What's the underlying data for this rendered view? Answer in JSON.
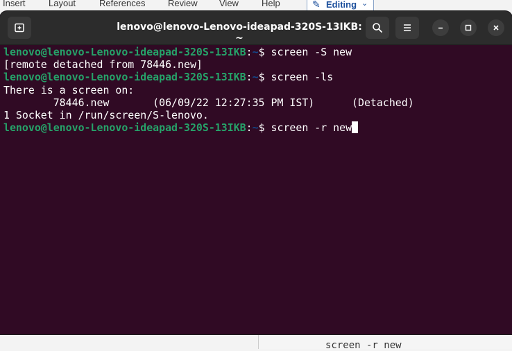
{
  "background_app": {
    "menu": [
      "Insert",
      "Layout",
      "References",
      "Review",
      "View",
      "Help"
    ],
    "mode_label": "Editing",
    "doc_text": "screen -r new"
  },
  "window": {
    "title": "lenovo@lenovo-Lenovo-ideapad-320S-13IKB: ~",
    "new_tab_icon": "new-tab-icon",
    "search_icon": "search-icon",
    "menu_icon": "hamburger-menu-icon",
    "minimize_icon": "minimize-icon",
    "maximize_icon": "maximize-icon",
    "close_icon": "close-icon"
  },
  "colors": {
    "terminal_bg": "#300a24",
    "prompt_user": "#26a269",
    "prompt_path": "#12488b",
    "text": "#ffffff",
    "header": "#2c2c2c"
  },
  "terminal": {
    "prompt_user": "lenovo@lenovo-Lenovo-ideapad-320S-13IKB",
    "prompt_sep": ":",
    "prompt_path": "~",
    "prompt_symbol": "$ ",
    "lines": [
      {
        "type": "prompt",
        "command": "screen -S new"
      },
      {
        "type": "output",
        "text": "[remote detached from 78446.new]"
      },
      {
        "type": "prompt",
        "command": "screen -ls"
      },
      {
        "type": "output",
        "text": "There is a screen on:"
      },
      {
        "type": "output",
        "text": "        78446.new       (06/09/22 12:27:35 PM IST)      (Detached)"
      },
      {
        "type": "output",
        "text": "1 Socket in /run/screen/S-lenovo."
      },
      {
        "type": "prompt",
        "command": "screen -r new",
        "cursor": true
      }
    ]
  }
}
